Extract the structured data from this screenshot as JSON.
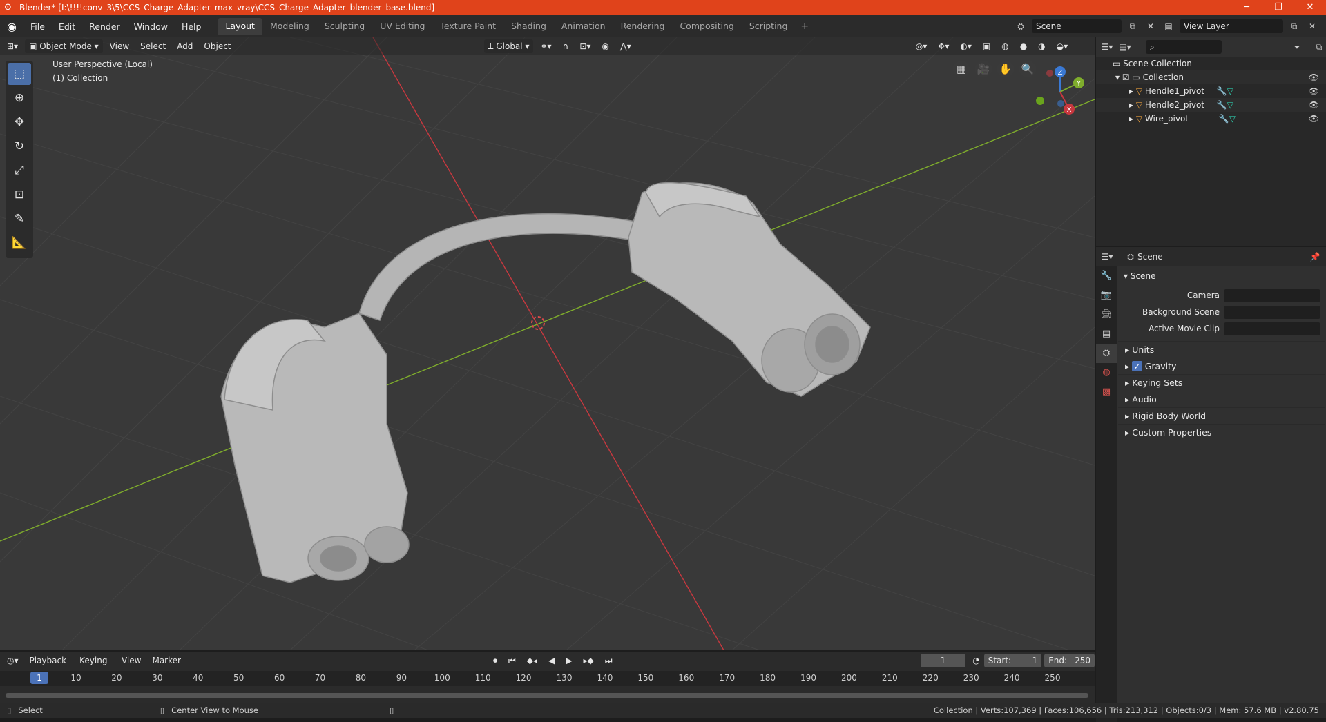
{
  "window": {
    "title": "Blender* [I:\\!!!!conv_3\\5\\CCS_Charge_Adapter_max_vray\\CCS_Charge_Adapter_blender_base.blend]",
    "minimize": "─",
    "maximize": "❐",
    "close": "✕"
  },
  "menu": {
    "items": [
      "File",
      "Edit",
      "Render",
      "Window",
      "Help"
    ]
  },
  "workspaces": {
    "tabs": [
      "Layout",
      "Modeling",
      "Sculpting",
      "UV Editing",
      "Texture Paint",
      "Shading",
      "Animation",
      "Rendering",
      "Compositing",
      "Scripting"
    ],
    "active": "Layout",
    "add": "+"
  },
  "scene_selector": {
    "value": "Scene"
  },
  "view_layer": {
    "value": "View Layer"
  },
  "viewport": {
    "mode": "Object Mode",
    "menus": [
      "View",
      "Select",
      "Add",
      "Object"
    ],
    "orientation": "Global",
    "overlay_line1": "User Perspective (Local)",
    "overlay_line2": "(1) Collection",
    "gizmo": {
      "x": "X",
      "y": "Y",
      "z": "Z"
    }
  },
  "outliner": {
    "root": "Scene Collection",
    "collection": "Collection",
    "objects": [
      "Hendle1_pivot",
      "Hendle2_pivot",
      "Wire_pivot"
    ]
  },
  "properties": {
    "header": "Scene",
    "panel": "Scene",
    "fields": [
      {
        "label": "Camera"
      },
      {
        "label": "Background Scene"
      },
      {
        "label": "Active Movie Clip"
      }
    ],
    "subpanels": [
      "Units",
      "Gravity",
      "Keying Sets",
      "Audio",
      "Rigid Body World",
      "Custom Properties"
    ]
  },
  "timeline": {
    "menus": [
      "Playback",
      "Keying",
      "View",
      "Marker"
    ],
    "current_frame": "1",
    "start_label": "Start:",
    "start": "1",
    "end_label": "End:",
    "end": "250",
    "ticks": [
      "1",
      "10",
      "20",
      "30",
      "40",
      "50",
      "60",
      "70",
      "80",
      "90",
      "100",
      "110",
      "120",
      "130",
      "140",
      "150",
      "160",
      "170",
      "180",
      "190",
      "200",
      "210",
      "220",
      "230",
      "240",
      "250"
    ]
  },
  "status": {
    "left": "Select",
    "middle": "Center View to Mouse",
    "right": "Collection | Verts:107,369 | Faces:106,656 | Tris:213,312 | Objects:0/3 | Mem: 57.6 MB | v2.80.75"
  },
  "colors": {
    "accent": "#4b72b8",
    "titlebar": "#e0431b",
    "x_axis": "#c8383f",
    "y_axis": "#7fad2c",
    "z_axis": "#3a79d4"
  }
}
